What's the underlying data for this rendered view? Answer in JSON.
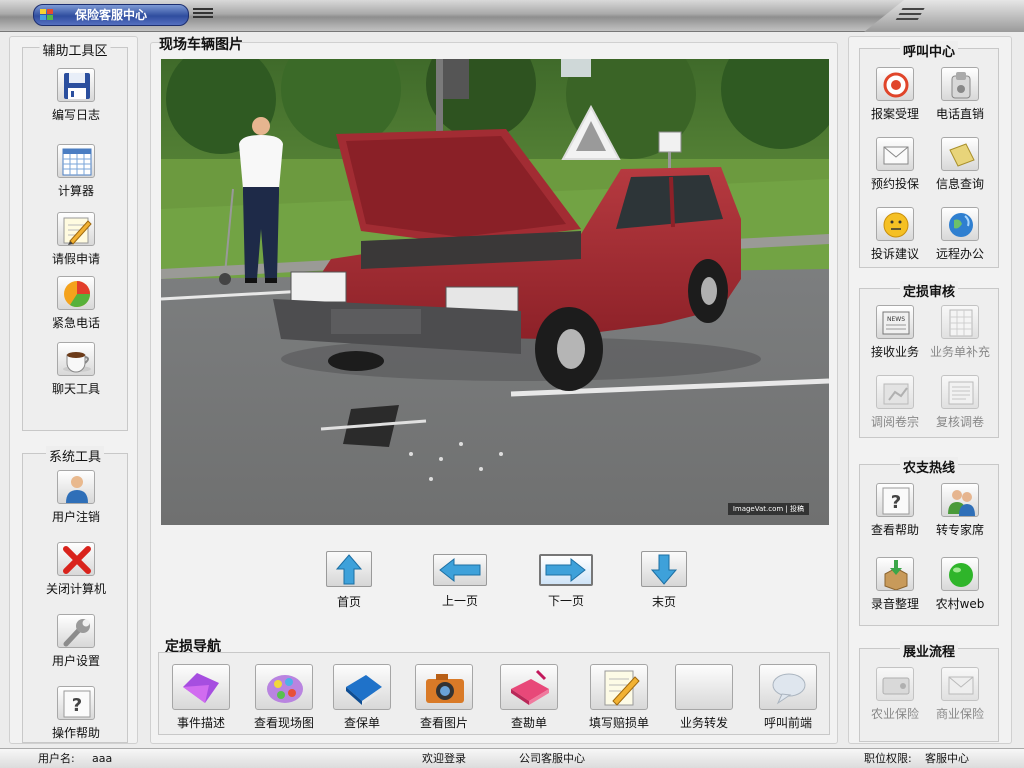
{
  "window": {
    "title": "保险客服中心"
  },
  "left_panel": {
    "aux_tools": {
      "title": "辅助工具区",
      "items": [
        {
          "label": "编写日志",
          "icon": "floppy-disk-icon"
        },
        {
          "label": "计算器",
          "icon": "spreadsheet-icon"
        },
        {
          "label": "请假申请",
          "icon": "pencil-note-icon"
        },
        {
          "label": "紧急电话",
          "icon": "pie-chart-icon"
        },
        {
          "label": "聊天工具",
          "icon": "coffee-cup-icon"
        }
      ]
    },
    "system_tools": {
      "title": "系统工具",
      "items": [
        {
          "label": "用户注销",
          "icon": "user-icon"
        },
        {
          "label": "关闭计算机",
          "icon": "red-x-icon"
        },
        {
          "label": "用户设置",
          "icon": "wrench-icon"
        },
        {
          "label": "操作帮助",
          "icon": "help-icon"
        }
      ]
    }
  },
  "main": {
    "photo_title": "现场车辆图片",
    "photo_watermark": "ImageVat.com | 投稿",
    "nav_buttons": [
      {
        "label": "首页",
        "icon": "arrow-up-icon"
      },
      {
        "label": "上一页",
        "icon": "arrow-left-icon"
      },
      {
        "label": "下一页",
        "icon": "arrow-right-icon",
        "active": true
      },
      {
        "label": "末页",
        "icon": "arrow-down-icon"
      }
    ],
    "loss_nav": {
      "title": "定损导航",
      "items": [
        {
          "label": "事件描述",
          "icon": "purple-envelope-icon"
        },
        {
          "label": "查看现场图",
          "icon": "palette-icon"
        },
        {
          "label": "查保单",
          "icon": "blue-book-icon"
        },
        {
          "label": "查看图片",
          "icon": "camera-icon"
        },
        {
          "label": "查勘单",
          "icon": "pink-box-icon"
        },
        {
          "label": "填写赔损单",
          "icon": "pencil-form-icon"
        },
        {
          "label": "业务转发",
          "icon": "blank-icon"
        },
        {
          "label": "呼叫前端",
          "icon": "speech-bubble-icon"
        }
      ]
    }
  },
  "right_panel": {
    "call_center": {
      "title": "呼叫中心",
      "items": [
        {
          "label": "报案受理",
          "icon": "target-icon"
        },
        {
          "label": "电话直销",
          "icon": "phone-tools-icon"
        },
        {
          "label": "预约投保",
          "icon": "envelope-icon"
        },
        {
          "label": "信息查询",
          "icon": "notepad-icon"
        },
        {
          "label": "投诉建议",
          "icon": "smiley-icon"
        },
        {
          "label": "远程办公",
          "icon": "globe-icon"
        }
      ]
    },
    "loss_review": {
      "title": "定损审核",
      "items": [
        {
          "label": "接收业务",
          "icon": "news-icon",
          "dim": false
        },
        {
          "label": "业务单补充",
          "icon": "grid-doc-icon",
          "dim": true
        },
        {
          "label": "调阅卷宗",
          "icon": "folder-chart-icon",
          "dim": true
        },
        {
          "label": "复核调卷",
          "icon": "list-doc-icon",
          "dim": true
        }
      ]
    },
    "agri_hotline": {
      "title": "农支热线",
      "items": [
        {
          "label": "查看帮助",
          "icon": "help-icon"
        },
        {
          "label": "转专家席",
          "icon": "users-icon"
        },
        {
          "label": "录音整理",
          "icon": "download-box-icon"
        },
        {
          "label": "农村web",
          "icon": "green-ball-icon"
        }
      ]
    },
    "business_flow": {
      "title": "展业流程",
      "items": [
        {
          "label": "农业保险",
          "icon": "drive-icon",
          "dim": true
        },
        {
          "label": "商业保险",
          "icon": "mail-icon",
          "dim": true
        }
      ]
    }
  },
  "status_bar": {
    "user_label": "用户名:",
    "user_value": "aaa",
    "welcome": "欢迎登录",
    "company": "公司客服中心",
    "role_label": "职位权限:",
    "role_value": "客服中心"
  },
  "colors": {
    "title_blue": "#2f4d9f",
    "panel_bg": "#eeeeee"
  }
}
